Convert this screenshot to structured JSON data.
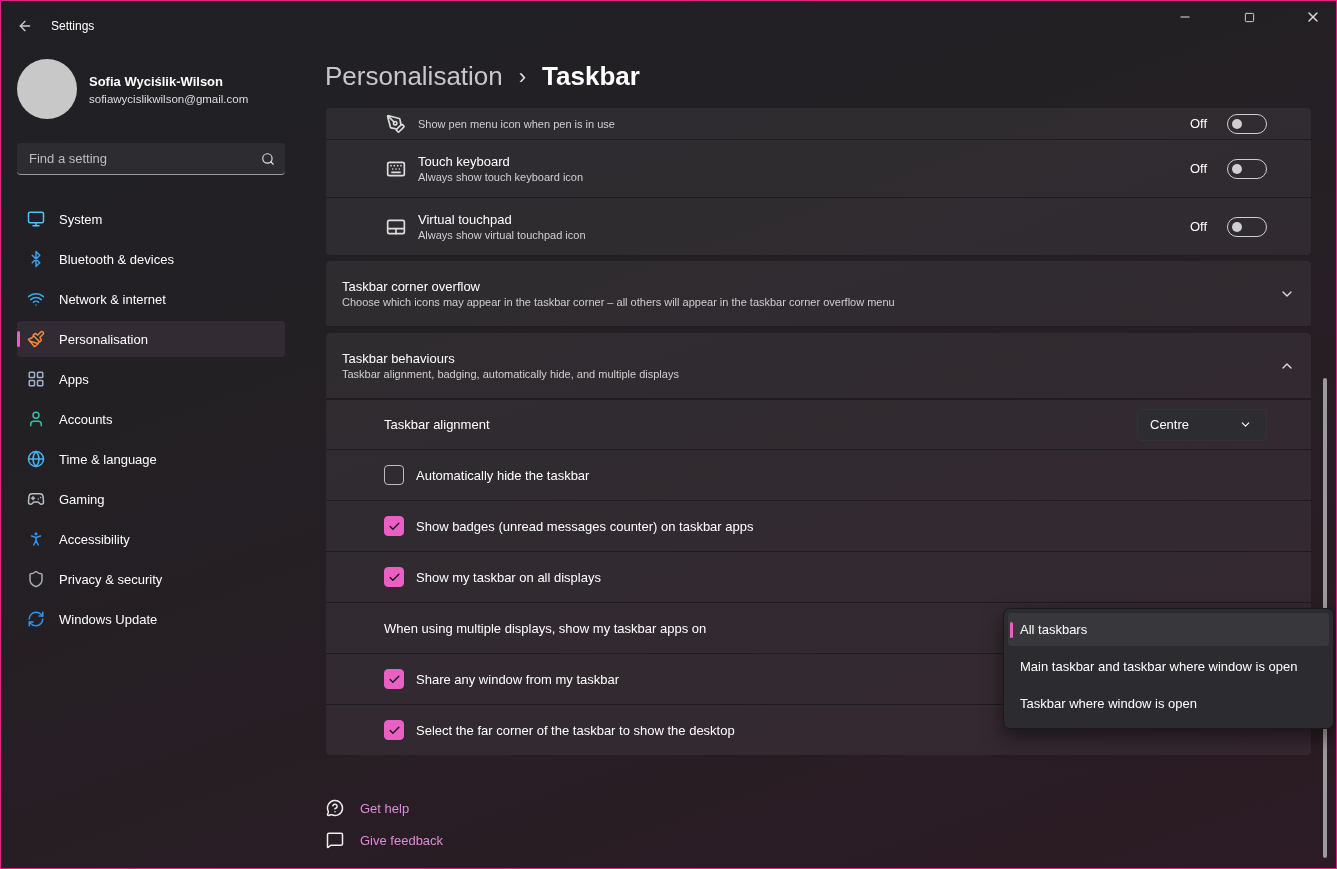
{
  "window": {
    "title": "Settings"
  },
  "user": {
    "name": "Sofia Wyciślik-Wilson",
    "email": "sofiawycislikwilson@gmail.com"
  },
  "search": {
    "placeholder": "Find a setting"
  },
  "nav": [
    {
      "kind": "system",
      "label": "System",
      "selected": false
    },
    {
      "kind": "bluetooth",
      "label": "Bluetooth & devices",
      "selected": false
    },
    {
      "kind": "network",
      "label": "Network & internet",
      "selected": false
    },
    {
      "kind": "brush",
      "label": "Personalisation",
      "selected": true
    },
    {
      "kind": "apps",
      "label": "Apps",
      "selected": false
    },
    {
      "kind": "accounts",
      "label": "Accounts",
      "selected": false
    },
    {
      "kind": "time",
      "label": "Time & language",
      "selected": false
    },
    {
      "kind": "gaming",
      "label": "Gaming",
      "selected": false
    },
    {
      "kind": "accessibility",
      "label": "Accessibility",
      "selected": false
    },
    {
      "kind": "privacy",
      "label": "Privacy & security",
      "selected": false
    },
    {
      "kind": "update",
      "label": "Windows Update",
      "selected": false
    }
  ],
  "breadcrumb": {
    "parent": "Personalisation",
    "separator": "›",
    "current": "Taskbar"
  },
  "corner_icons": [
    {
      "kind": "pen",
      "subtitle": "Show pen menu icon when pen is in use",
      "state_label": "Off",
      "on": false
    },
    {
      "kind": "keyboard",
      "title": "Touch keyboard",
      "subtitle": "Always show touch keyboard icon",
      "state_label": "Off",
      "on": false
    },
    {
      "kind": "touchpad",
      "title": "Virtual touchpad",
      "subtitle": "Always show virtual touchpad icon",
      "state_label": "Off",
      "on": false
    }
  ],
  "sections": [
    {
      "title": "Taskbar corner overflow",
      "subtitle": "Choose which icons may appear in the taskbar corner – all others will appear in the taskbar corner overflow menu",
      "expanded": false
    },
    {
      "title": "Taskbar behaviours",
      "subtitle": "Taskbar alignment, badging, automatically hide, and multiple displays",
      "expanded": true
    }
  ],
  "behaviours": [
    {
      "kind": "dropdown",
      "label": "Taskbar alignment",
      "value": "Centre"
    },
    {
      "kind": "checkbox",
      "label": "Automatically hide the taskbar",
      "checked": false
    },
    {
      "kind": "checkbox",
      "label": "Show badges (unread messages counter) on taskbar apps",
      "checked": true
    },
    {
      "kind": "checkbox",
      "label": "Show my taskbar on all displays",
      "checked": true
    },
    {
      "kind": "menu",
      "label": "When using multiple displays, show my taskbar apps on"
    },
    {
      "kind": "checkbox",
      "label": "Share any window from my taskbar",
      "checked": true
    },
    {
      "kind": "checkbox",
      "label": "Select the far corner of the taskbar to show the desktop",
      "checked": true
    }
  ],
  "popup_menu": [
    {
      "label": "All taskbars",
      "selected": true
    },
    {
      "label": "Main taskbar and taskbar where window is open",
      "selected": false
    },
    {
      "label": "Taskbar where window is open",
      "selected": false
    }
  ],
  "links": [
    {
      "kind": "help",
      "label": "Get help"
    },
    {
      "kind": "feedback",
      "label": "Give feedback"
    }
  ]
}
